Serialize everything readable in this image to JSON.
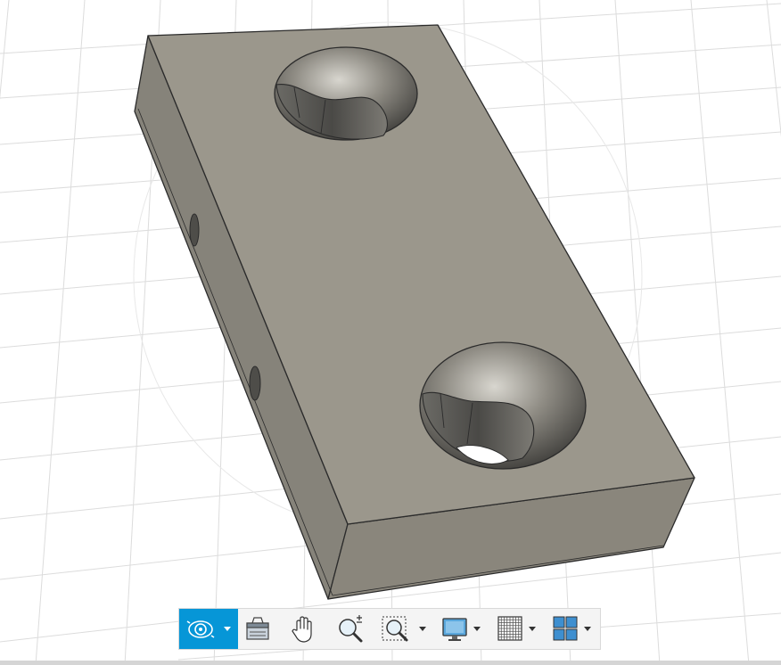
{
  "viewport": {
    "background": "#ffffff",
    "grid_color": "#dcdcdc",
    "part": {
      "top_face_color": "#9b978c",
      "left_face_color": "#86837a",
      "front_face_color": "#8c887e",
      "edge_color": "#2b2b2b",
      "hole_interior_color": "#5f5e59",
      "through_hole_color": "#ffffff",
      "counterbores": 2,
      "side_holes": 2
    }
  },
  "toolbar": {
    "accent_color": "#0696d7",
    "buttons": [
      {
        "name": "orbit",
        "icon": "orbit-icon",
        "active": true,
        "dropdown": true
      },
      {
        "name": "look-at",
        "icon": "look-at-icon",
        "active": false,
        "dropdown": false
      },
      {
        "name": "pan",
        "icon": "pan-hand-icon",
        "active": false,
        "dropdown": false
      },
      {
        "name": "zoom",
        "icon": "zoom-icon",
        "active": false,
        "dropdown": false
      },
      {
        "name": "fit",
        "icon": "zoom-window-icon",
        "active": false,
        "dropdown": true
      },
      {
        "name": "display-settings",
        "icon": "monitor-icon",
        "active": false,
        "dropdown": true
      },
      {
        "name": "grid-snaps",
        "icon": "grid-icon",
        "active": false,
        "dropdown": true
      },
      {
        "name": "viewports",
        "icon": "viewports-icon",
        "active": false,
        "dropdown": true
      }
    ]
  }
}
